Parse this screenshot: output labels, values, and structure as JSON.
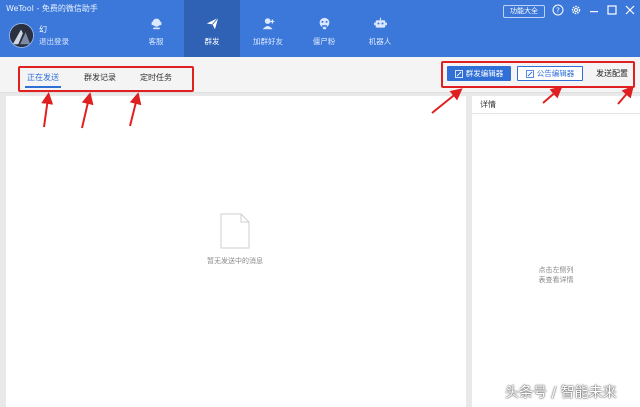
{
  "app": {
    "title": "WeTool - 免费的微信助手"
  },
  "user": {
    "name": "幻",
    "logout": "退出登录"
  },
  "nav": [
    {
      "label": "客服",
      "icon": "customer-service-icon"
    },
    {
      "label": "群发",
      "icon": "send-plane-icon"
    },
    {
      "label": "加群好友",
      "icon": "add-friend-icon"
    },
    {
      "label": "僵尸粉",
      "icon": "zombie-icon"
    },
    {
      "label": "机器人",
      "icon": "robot-icon"
    }
  ],
  "window": {
    "features_label": "功能大全"
  },
  "tabs": [
    {
      "label": "正在发送"
    },
    {
      "label": "群发记录"
    },
    {
      "label": "定时任务"
    }
  ],
  "actions": {
    "mass_editor": "群发编辑器",
    "notice_editor": "公告编辑器",
    "send_config": "发送配置"
  },
  "main": {
    "empty_text": "暂无发送中的消息"
  },
  "detail": {
    "title": "详情",
    "hint_line1": "点击左侧列",
    "hint_line2": "表查看详情"
  },
  "watermark": "头条号 / 智能未来",
  "colors": {
    "brand": "#3b78d9",
    "accent": "#2f6fd6",
    "annotation": "#e02020"
  }
}
